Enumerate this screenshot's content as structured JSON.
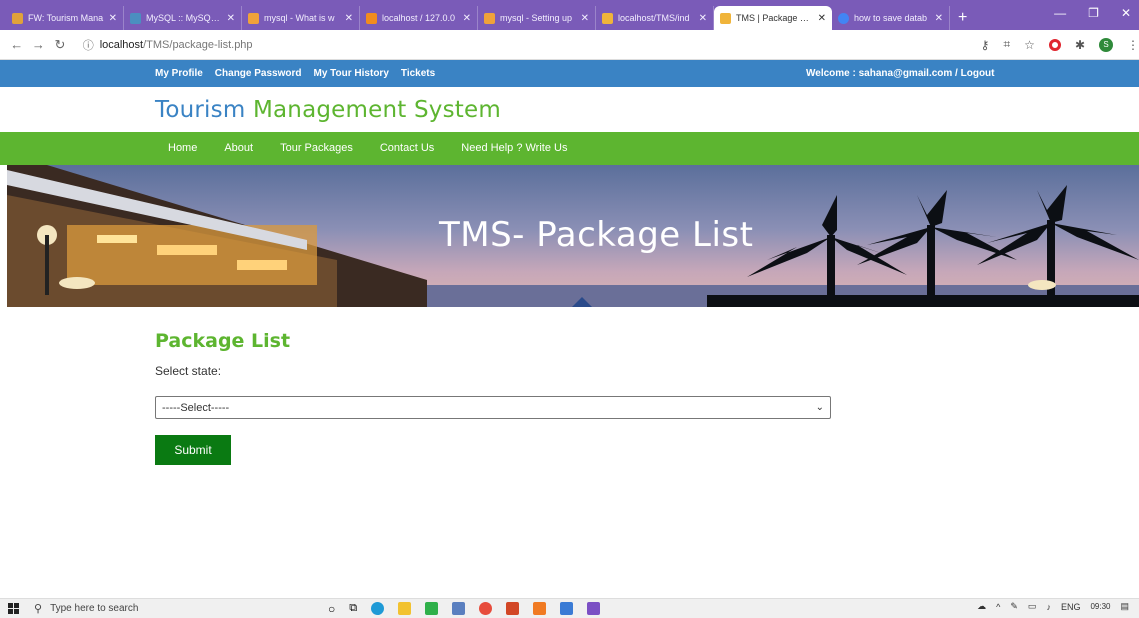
{
  "browser": {
    "tabs": [
      {
        "label": "FW: Tourism Mana",
        "color": "#e0a23a"
      },
      {
        "label": "MySQL :: MySQL S",
        "color": "#4b8fc0"
      },
      {
        "label": "mysql - What is w",
        "color": "#f0a23a"
      },
      {
        "label": "localhost / 127.0.0",
        "color": "#f28c1e"
      },
      {
        "label": "mysql - Setting up",
        "color": "#f0a23a"
      },
      {
        "label": "localhost/TMS/ind",
        "color": "#f0b43a"
      },
      {
        "label": "TMS | Package List",
        "color": "#f0b43a"
      },
      {
        "label": "how to save datab",
        "color": "#4285f4"
      }
    ],
    "url_host": "localhost",
    "url_path": "/TMS/package-list.php"
  },
  "site": {
    "top_links": [
      "My Profile",
      "Change Password",
      "My Tour History",
      "Tickets"
    ],
    "welcome": "Welcome :  sahana@gmail.com / Logout",
    "brand_part1": "Tourism",
    "brand_part2": "Management System",
    "nav": [
      "Home",
      "About",
      "Tour Packages",
      "Contact Us",
      "Need Help ? Write Us"
    ],
    "banner_title": "TMS- Package List",
    "heading": "Package List",
    "select_label": "Select state:",
    "select_value": "-----Select-----",
    "submit_label": "Submit"
  },
  "taskbar": {
    "search_placeholder": "Type here to search",
    "lang": "ENG",
    "time": "09:30"
  }
}
